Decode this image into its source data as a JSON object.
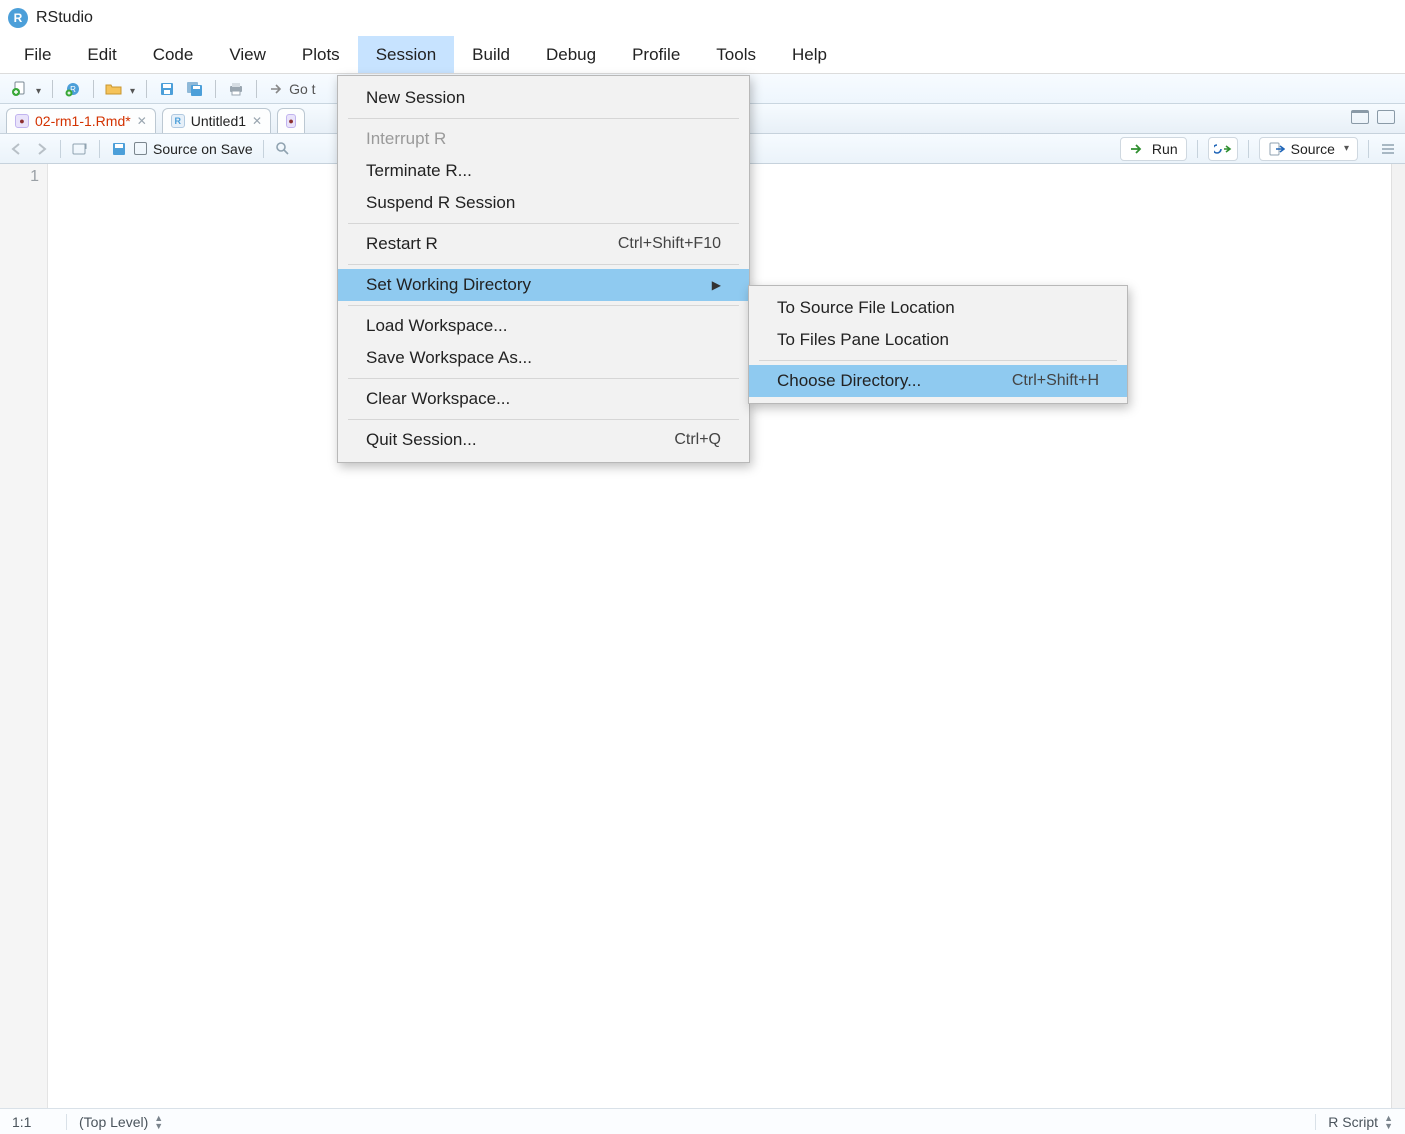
{
  "app": {
    "title": "RStudio"
  },
  "menubar": {
    "items": [
      "File",
      "Edit",
      "Code",
      "View",
      "Plots",
      "Session",
      "Build",
      "Debug",
      "Profile",
      "Tools",
      "Help"
    ],
    "active_index": 5
  },
  "toolbar": {
    "go_label": "Go t"
  },
  "tabs": [
    {
      "name": "02-rm1-1.Rmd*",
      "dirty": true,
      "icon": "rmd"
    },
    {
      "name": "Untitled1",
      "dirty": false,
      "icon": "r"
    }
  ],
  "source_toolbar": {
    "source_on_save": "Source on Save",
    "run_label": "Run",
    "source_label": "Source"
  },
  "editor": {
    "gutter_lines": [
      "1"
    ]
  },
  "statusbar": {
    "rowcol": "1:1",
    "scope": "(Top Level)",
    "script": "R Script"
  },
  "session_menu": {
    "new_session": "New Session",
    "interrupt": "Interrupt R",
    "terminate": "Terminate R...",
    "suspend": "Suspend R Session",
    "restart": {
      "label": "Restart R",
      "shortcut": "Ctrl+Shift+F10"
    },
    "swd": "Set Working Directory",
    "load_ws": "Load Workspace...",
    "save_ws": "Save Workspace As...",
    "clear_ws": "Clear Workspace...",
    "quit": {
      "label": "Quit Session...",
      "shortcut": "Ctrl+Q"
    }
  },
  "swd_submenu": {
    "to_source": "To Source File Location",
    "to_files": "To Files Pane Location",
    "choose": {
      "label": "Choose Directory...",
      "shortcut": "Ctrl+Shift+H"
    }
  }
}
